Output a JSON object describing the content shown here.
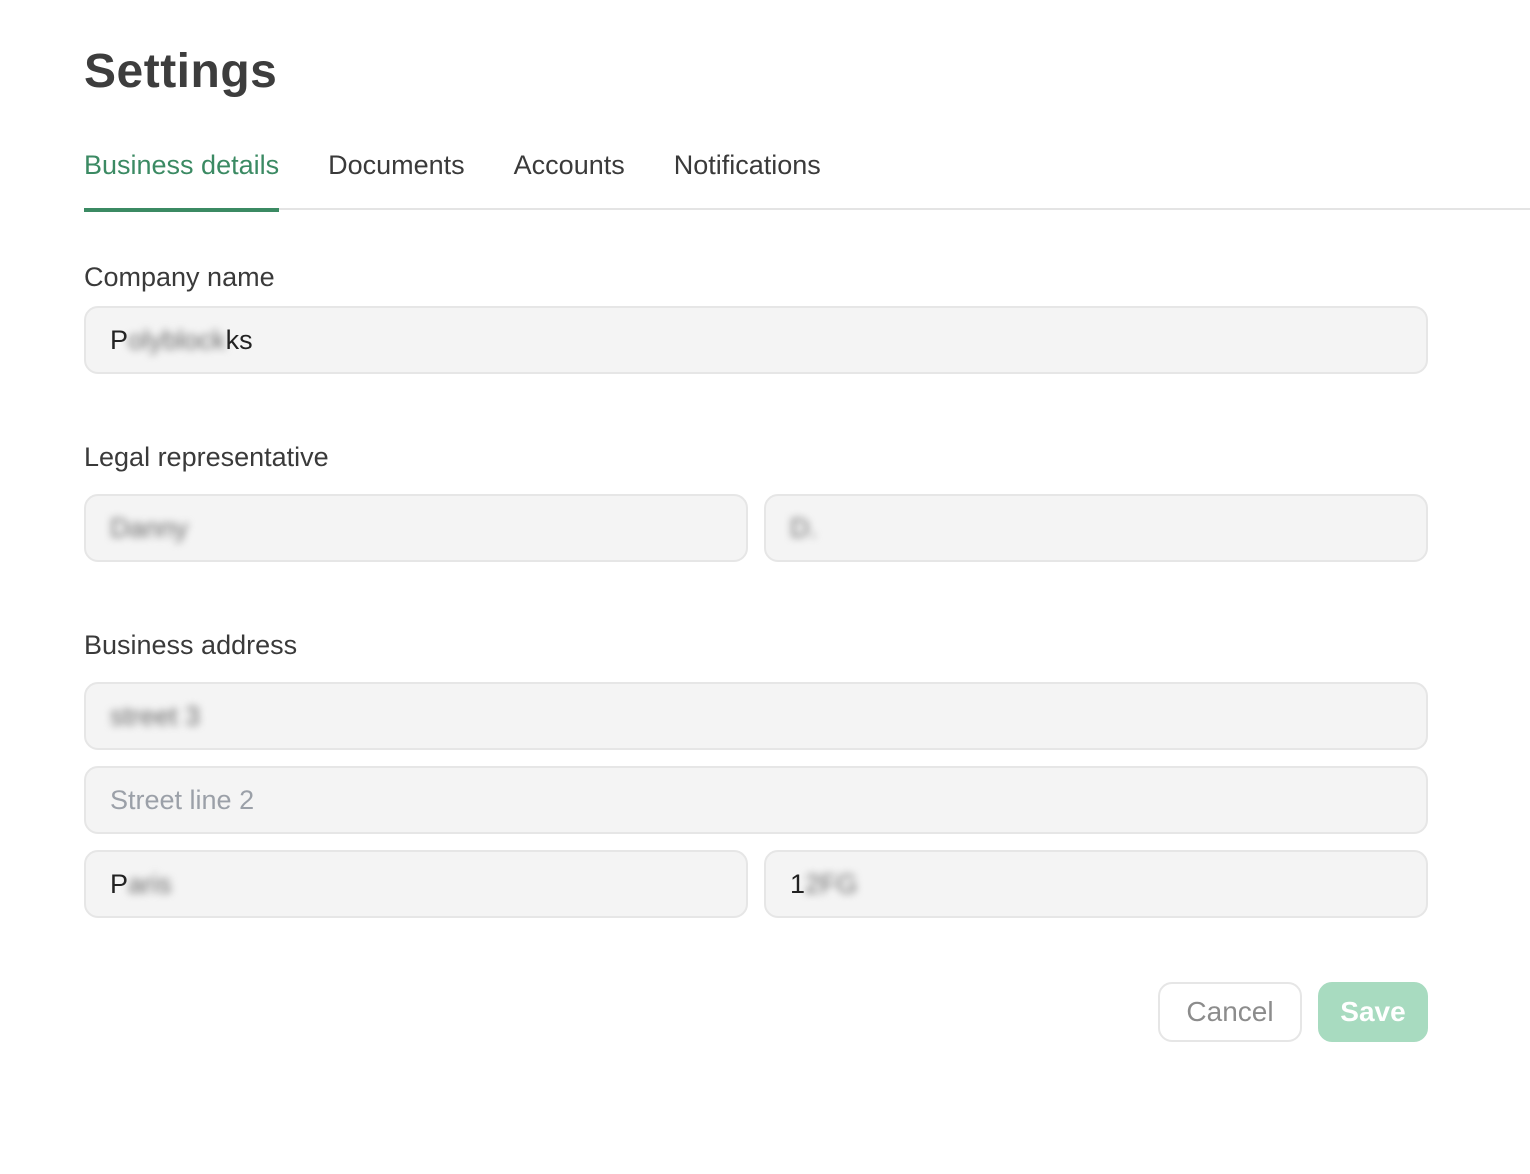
{
  "page": {
    "title": "Settings"
  },
  "tabs": [
    {
      "label": "Business details",
      "active": true
    },
    {
      "label": "Documents",
      "active": false
    },
    {
      "label": "Accounts",
      "active": false
    },
    {
      "label": "Notifications",
      "active": false
    }
  ],
  "company": {
    "label": "Company name",
    "value_prefix": "P",
    "value_obscured": "olyblock",
    "value_suffix": "ks"
  },
  "legal_rep": {
    "label": "Legal representative",
    "first_name_obscured": "Danny",
    "last_name_obscured": "D."
  },
  "address": {
    "label": "Business address",
    "street1_obscured": "street 3",
    "street2_placeholder": "Street line 2",
    "city_prefix": "P",
    "city_obscured": "aris",
    "postcode_prefix": "1",
    "postcode_obscured": "2FG"
  },
  "actions": {
    "cancel_label": "Cancel",
    "save_label": "Save"
  },
  "colors": {
    "accent": "#3b8a63",
    "save_disabled": "#a8dbc0",
    "field_bg": "#f4f4f4",
    "placeholder": "#9ba0a8"
  }
}
